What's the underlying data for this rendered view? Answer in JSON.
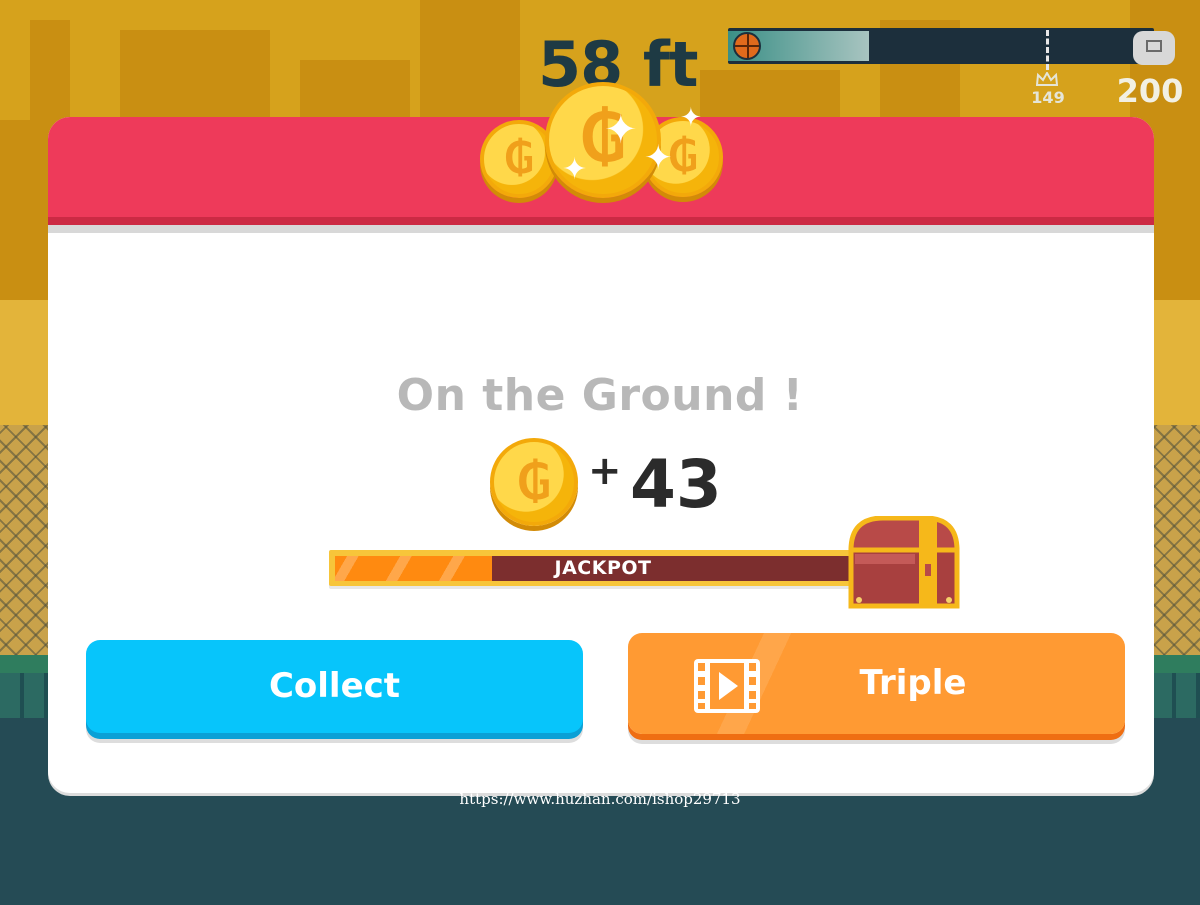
{
  "hud": {
    "distance": "58 ft",
    "progress_fraction": 0.33,
    "record_value": "149",
    "goal_value": "200",
    "icons": {
      "ball": "basketball-icon",
      "record": "crown-icon",
      "goal": "hoop-icon"
    }
  },
  "dialog": {
    "title": "On the Ground !",
    "reward_plus": "+",
    "reward_amount": "43",
    "coin_symbol": "₲",
    "jackpot": {
      "label": "JACKPOT",
      "progress_fraction": 0.3
    },
    "buttons": {
      "collect": "Collect",
      "triple": "Triple"
    },
    "colors": {
      "header": "#ee3a5a",
      "collect": "#07c5fb",
      "triple": "#ff9a33",
      "coin": "#ffd84a"
    }
  },
  "watermark": "https://www.huzhan.com/ishop29713"
}
